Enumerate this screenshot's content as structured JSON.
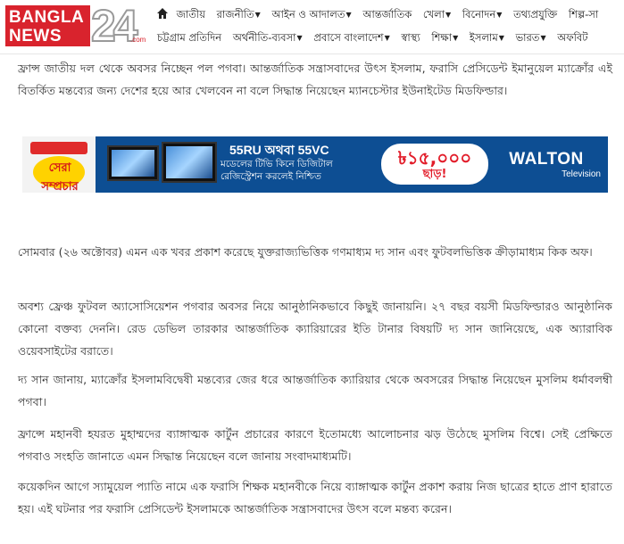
{
  "site": {
    "logo_top": "BANGLA",
    "logo_bottom": "NEWS",
    "logo_number": "24",
    "logo_domain": ".com"
  },
  "nav": {
    "row1": [
      {
        "label": "জাতীয়",
        "dropdown": false
      },
      {
        "label": "রাজনীতি",
        "dropdown": true
      },
      {
        "label": "আইন ও আদালত",
        "dropdown": true
      },
      {
        "label": "আন্তর্জাতিক",
        "dropdown": false
      },
      {
        "label": "খেলা",
        "dropdown": true
      },
      {
        "label": "বিনোদন",
        "dropdown": true
      },
      {
        "label": "তথ্যপ্রযুক্তি",
        "dropdown": false
      },
      {
        "label": "শিল্প-সা",
        "dropdown": false
      }
    ],
    "row2": [
      {
        "label": "চট্টগ্রাম প্রতিদিন",
        "dropdown": false
      },
      {
        "label": "অর্থনীতি-ব্যবসা",
        "dropdown": true
      },
      {
        "label": "প্রবাসে বাংলাদেশ",
        "dropdown": true
      },
      {
        "label": "স্বাস্থ্য",
        "dropdown": false
      },
      {
        "label": "শিক্ষা",
        "dropdown": true
      },
      {
        "label": "ইসলাম",
        "dropdown": true
      },
      {
        "label": "ভারত",
        "dropdown": true
      },
      {
        "label": "অফবিট",
        "dropdown": false
      }
    ]
  },
  "ad": {
    "badge": "সেরা সম্প্রচার",
    "headline": "55RU অথবা 55VC",
    "subline1": "মডেলের টিভি কিনে ডিজিটাল",
    "subline2": "রেজিস্ট্রেশন করলেই নিশ্চিত",
    "price": "৳১৫,০০০",
    "discount": "ছাড়!",
    "brand": "WALTON",
    "brand_sub": "Television"
  },
  "article": {
    "paragraphs": [
      "ফ্রান্স জাতীয় দল থেকে অবসর নিচ্ছেন পল পগবা। আন্তর্জাতিক সন্ত্রাসবাদের উৎস ইসলাম, ফরাসি প্রেসিডেন্ট ইমানুয়েল ম্যাক্রোঁর এই বিতর্কিত মন্তব্যের জন্য দেশের হয়ে আর খেলবেন না বলে সিদ্ধান্ত নিয়েছেন ম্যানচেস্টার ইউনাইটেড মিডফিল্ডার।",
      "সোমবার (২৬ অক্টোবর) এমন এক খবর প্রকাশ করেছে যুক্তরাজ্যভিত্তিক গণমাধ্যম দ্য সান এবং ফুটবলভিত্তিক ক্রীড়ামাধ্যম কিক অফ।",
      "অবশ্য ফ্রেঞ্চ ফুটবল অ্যাসোসিয়েশন পগবার অবসর নিয়ে আনুষ্ঠানিকভাবে কিছুই জানায়নি। ২৭ বছর বয়সী মিডফিল্ডারও আনুষ্ঠানিক কোনো বক্তব্য দেননি। রেড ডেভিল তারকার আন্তর্জাতিক ক্যারিয়ারের ইতি টানার বিষয়টি দ্য সান জানিয়েছে, এক অ্যারাবিক ওয়েবসাইটের বরাতে।",
      "দ্য সান জানায়, ম্যাক্রোঁর ইসলামবিদ্বেষী মন্তব্যের জের ধরে আন্তর্জাতিক ক্যারিয়ার থেকে অবসরের সিদ্ধান্ত নিয়েছেন মুসলিম ধর্মাবলম্বী পগবা।",
      "ফ্রান্সে মহানবী হযরত মুহাম্মদের ব্যাঙ্গাত্মক কার্টুন প্রচারের কারণে ইতোমধ্যে আলোচনার ঝড় উঠেছে মুসলিম বিশ্বে। সেই প্রেক্ষিতে পগবাও সংহতি জানাতে এমন সিদ্ধান্ত নিয়েছেন বলে জানায় সংবাদমাধ্যমটি।",
      "কয়েকদিন আগে স্যামুয়েল প্যাতি নামে এক ফরাসি শিক্ষক মহানবীকে নিয়ে ব্যাঙ্গাত্মক কার্টুন প্রকাশ করায় নিজ ছাত্রের হাতে প্রাণ হারাতে হয়। এই ঘটনার পর ফরাসি প্রেসিডেন্ট ইসলামকে আন্তর্জাতিক সন্ত্রাসবাদের উৎস বলে মন্তব্য করেন।"
    ]
  }
}
